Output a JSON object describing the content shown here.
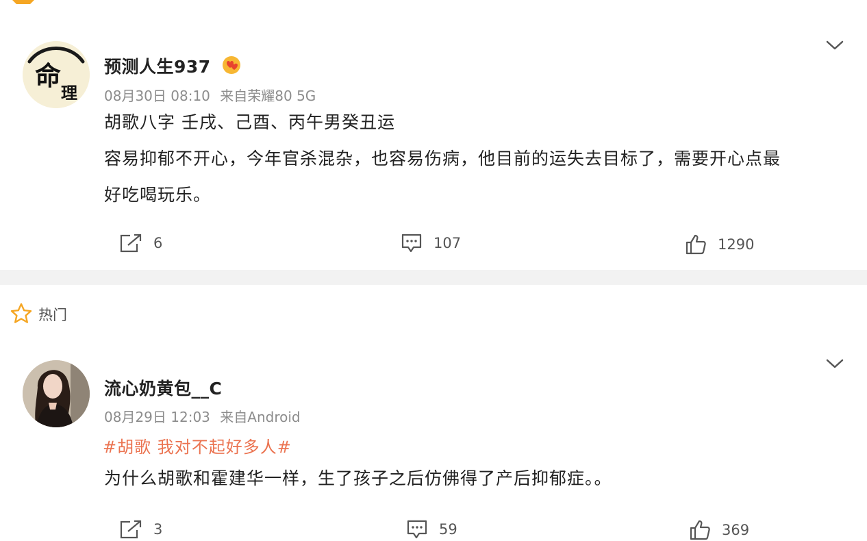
{
  "post1": {
    "username": "预测人生937",
    "badge_icon": "vip-heart-badge-icon",
    "date": "08月30日 08:10",
    "source_prefix": "来自",
    "source": "荣耀80 5G",
    "avatar_text_top": "命",
    "avatar_text_bottom": "理",
    "lines": [
      "胡歌八字 壬戌、己酉、丙午男癸丑运",
      "容易抑郁不开心，今年官杀混杂，也容易伤病，他目前的运失去目标了，需要开心点最",
      "好吃喝玩乐。"
    ],
    "actions": {
      "repost_count": "6",
      "comment_count": "107",
      "like_count": "1290"
    }
  },
  "hot": {
    "label": "热门"
  },
  "post2": {
    "username": "流心奶黄包__C",
    "date": "08月29日 12:03",
    "source_prefix": "来自",
    "source": "Android",
    "hashtag": "#胡歌 我对不起好多人#",
    "line": "为什么胡歌和霍建华一样，生了孩子之后仿佛得了产后抑郁症。。",
    "actions": {
      "repost_count": "3",
      "comment_count": "59",
      "like_count": "369"
    }
  },
  "colors": {
    "hashtag": "#eb7350",
    "meta": "#8c8c8c",
    "divider": "#f2f2f2",
    "star": "#f5a623"
  }
}
